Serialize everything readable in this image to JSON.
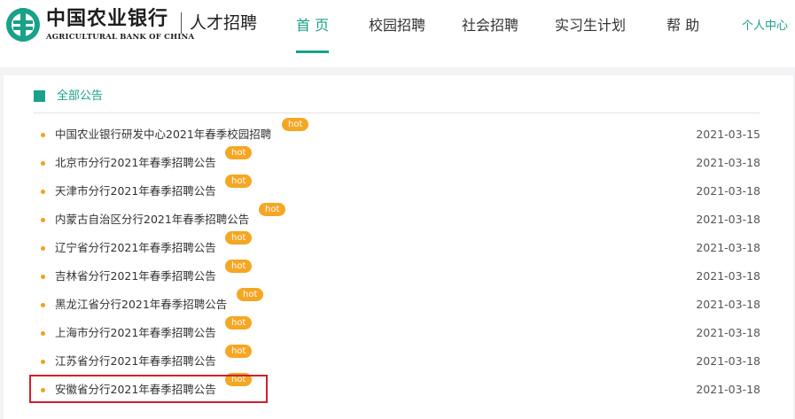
{
  "header": {
    "brand_cn": "中国农业银行",
    "brand_en": "AGRICULTURAL BANK OF CHINA",
    "brand_sub": "人才招聘",
    "nav": [
      "首 页",
      "校园招聘",
      "社会招聘",
      "实习生计划",
      "帮 助"
    ],
    "user_center": "个人中心"
  },
  "colors": {
    "accent": "#1aa189",
    "hot": "#f5a623",
    "highlight": "#d0202a"
  },
  "section": {
    "title": "全部公告"
  },
  "hot_label": "hot",
  "announcements": [
    {
      "title": "中国农业银行研发中心2021年春季校园招聘",
      "hot": "hot",
      "date": "2021-03-15"
    },
    {
      "title": "北京市分行2021年春季招聘公告",
      "hot": "hot",
      "date": "2021-03-18"
    },
    {
      "title": "天津市分行2021年春季招聘公告",
      "hot": "hot",
      "date": "2021-03-18"
    },
    {
      "title": "内蒙古自治区分行2021年春季招聘公告",
      "hot": "hot",
      "date": "2021-03-18"
    },
    {
      "title": "辽宁省分行2021年春季招聘公告",
      "hot": "hot",
      "date": "2021-03-18"
    },
    {
      "title": "吉林省分行2021年春季招聘公告",
      "hot": "hot",
      "date": "2021-03-18"
    },
    {
      "title": "黑龙江省分行2021年春季招聘公告",
      "hot": "hot",
      "date": "2021-03-18"
    },
    {
      "title": "上海市分行2021年春季招聘公告",
      "hot": "hot",
      "date": "2021-03-18"
    },
    {
      "title": "江苏省分行2021年春季招聘公告",
      "hot": "hot",
      "date": "2021-03-18"
    },
    {
      "title": "安徽省分行2021年春季招聘公告",
      "hot": "hot",
      "date": "2021-03-18"
    }
  ]
}
